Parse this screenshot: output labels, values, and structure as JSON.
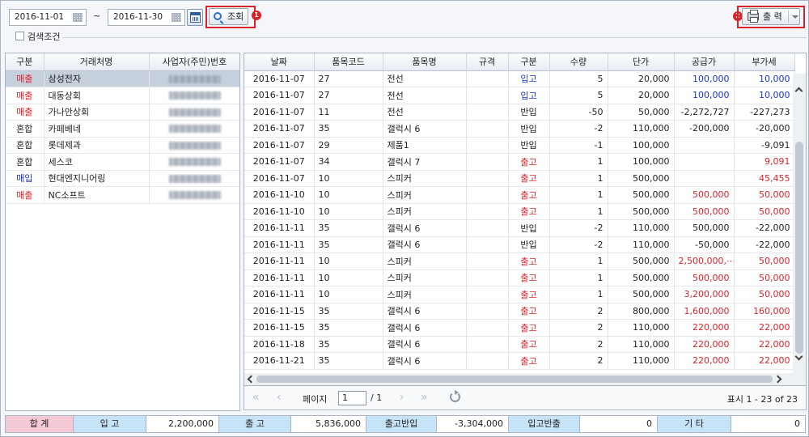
{
  "toolbar": {
    "start_date": "2016-11-01",
    "end_date": "2016-11-30",
    "tilde": "~",
    "search_label": "조회",
    "search_badge": "1",
    "print_label": "출 력",
    "print_badge": "2",
    "search_condition_label": "검색조건"
  },
  "left_table": {
    "headers": [
      "구분",
      "거래처명",
      "사업자(주민)번호"
    ],
    "rows": [
      {
        "type": "매출",
        "name": "삼성전자",
        "color": "#d9232a",
        "selected": true
      },
      {
        "type": "매출",
        "name": "대동상회",
        "color": "#d9232a"
      },
      {
        "type": "매출",
        "name": "가나안상회",
        "color": "#d9232a"
      },
      {
        "type": "혼합",
        "name": "카페베네",
        "color": "#222222"
      },
      {
        "type": "혼합",
        "name": "롯데제과",
        "color": "#222222"
      },
      {
        "type": "혼합",
        "name": "세스코",
        "color": "#222222"
      },
      {
        "type": "매입",
        "name": "현대엔지니어링",
        "color": "#1a35c8"
      },
      {
        "type": "매출",
        "name": "NC소프트",
        "color": "#d9232a"
      }
    ]
  },
  "right_table": {
    "headers": [
      "날짜",
      "품목코드",
      "품목명",
      "규격",
      "구분",
      "수량",
      "단가",
      "공급가",
      "부가세"
    ],
    "rows": [
      {
        "date": "2016-11-07",
        "code": "27",
        "item": "전선",
        "spec": "",
        "kind": "입고",
        "qty": "5",
        "price": "20,000",
        "supply": "100,000",
        "vat": "10,000",
        "kc": "blue",
        "sc": "blue",
        "vc": "blue"
      },
      {
        "date": "2016-11-07",
        "code": "27",
        "item": "전선",
        "spec": "",
        "kind": "입고",
        "qty": "5",
        "price": "20,000",
        "supply": "100,000",
        "vat": "10,000",
        "kc": "blue",
        "sc": "blue",
        "vc": "blue"
      },
      {
        "date": "2016-11-07",
        "code": "11",
        "item": "전선",
        "spec": "",
        "kind": "반입",
        "qty": "-50",
        "price": "50,000",
        "supply": "-2,272,727",
        "vat": "-227,273",
        "kc": "",
        "sc": "",
        "vc": ""
      },
      {
        "date": "2016-11-07",
        "code": "35",
        "item": "갤럭시 6",
        "spec": "",
        "kind": "반입",
        "qty": "-2",
        "price": "110,000",
        "supply": "-200,000",
        "vat": "-20,000",
        "kc": "",
        "sc": "",
        "vc": ""
      },
      {
        "date": "2016-11-07",
        "code": "29",
        "item": "제품1",
        "spec": "",
        "kind": "반입",
        "qty": "-1",
        "price": "100,000",
        "supply": "",
        "vat": "-9,091",
        "kc": "",
        "sc": "",
        "vc": ""
      },
      {
        "date": "2016-11-07",
        "code": "34",
        "item": "갤럭시 7",
        "spec": "",
        "kind": "출고",
        "qty": "1",
        "price": "100,000",
        "supply": "",
        "vat": "9,091",
        "kc": "red",
        "sc": "",
        "vc": "red"
      },
      {
        "date": "2016-11-07",
        "code": "10",
        "item": "스피커",
        "spec": "",
        "kind": "출고",
        "qty": "1",
        "price": "500,000",
        "supply": "",
        "vat": "45,455",
        "kc": "red",
        "sc": "",
        "vc": "red"
      },
      {
        "date": "2016-11-10",
        "code": "10",
        "item": "스피커",
        "spec": "",
        "kind": "출고",
        "qty": "1",
        "price": "500,000",
        "supply": "500,000",
        "vat": "50,000",
        "kc": "red",
        "sc": "red",
        "vc": "red"
      },
      {
        "date": "2016-11-10",
        "code": "10",
        "item": "스피커",
        "spec": "",
        "kind": "출고",
        "qty": "1",
        "price": "500,000",
        "supply": "500,000",
        "vat": "50,000",
        "kc": "red",
        "sc": "red",
        "vc": "red"
      },
      {
        "date": "2016-11-11",
        "code": "35",
        "item": "갤럭시 6",
        "spec": "",
        "kind": "반입",
        "qty": "-2",
        "price": "110,000",
        "supply": "500,000",
        "vat": "-22,000",
        "kc": "",
        "sc": "",
        "vc": ""
      },
      {
        "date": "2016-11-11",
        "code": "35",
        "item": "갤럭시 6",
        "spec": "",
        "kind": "반입",
        "qty": "-2",
        "price": "110,000",
        "supply": "-50,000",
        "vat": "-22,000",
        "kc": "",
        "sc": "",
        "vc": ""
      },
      {
        "date": "2016-11-11",
        "code": "10",
        "item": "스피커",
        "spec": "",
        "kind": "출고",
        "qty": "1",
        "price": "500,000",
        "supply": "2,500,000,⋯",
        "vat": "50,000",
        "kc": "red",
        "sc": "red",
        "vc": "red"
      },
      {
        "date": "2016-11-11",
        "code": "10",
        "item": "스피커",
        "spec": "",
        "kind": "출고",
        "qty": "1",
        "price": "500,000",
        "supply": "500,000",
        "vat": "50,000",
        "kc": "red",
        "sc": "red",
        "vc": "red"
      },
      {
        "date": "2016-11-11",
        "code": "10",
        "item": "스피커",
        "spec": "",
        "kind": "출고",
        "qty": "1",
        "price": "500,000",
        "supply": "3,200,000",
        "vat": "50,000",
        "kc": "red",
        "sc": "red",
        "vc": "red"
      },
      {
        "date": "2016-11-15",
        "code": "35",
        "item": "갤럭시 6",
        "spec": "",
        "kind": "출고",
        "qty": "2",
        "price": "800,000",
        "supply": "1,600,000",
        "vat": "160,000",
        "kc": "red",
        "sc": "red",
        "vc": "red"
      },
      {
        "date": "2016-11-15",
        "code": "35",
        "item": "갤럭시 6",
        "spec": "",
        "kind": "출고",
        "qty": "2",
        "price": "110,000",
        "supply": "220,000",
        "vat": "22,000",
        "kc": "red",
        "sc": "red",
        "vc": "red"
      },
      {
        "date": "2016-11-18",
        "code": "35",
        "item": "갤럭시 6",
        "spec": "",
        "kind": "출고",
        "qty": "2",
        "price": "110,000",
        "supply": "220,000",
        "vat": "22,000",
        "kc": "red",
        "sc": "red",
        "vc": "red"
      },
      {
        "date": "2016-11-21",
        "code": "35",
        "item": "갤럭시 6",
        "spec": "",
        "kind": "출고",
        "qty": "2",
        "price": "110,000",
        "supply": "220,000",
        "vat": "22,000",
        "kc": "red",
        "sc": "red",
        "vc": "red"
      }
    ]
  },
  "pager": {
    "page_label": "페이지",
    "page_value": "1",
    "page_total": "/ 1",
    "status": "표시 1 - 23 of 23"
  },
  "summary": {
    "total_label": "합 계",
    "in_label": "입 고",
    "in_value": "2,200,000",
    "out_label": "출 고",
    "out_value": "5,836,000",
    "out_return_label": "출고반입",
    "out_return_value": "-3,304,000",
    "in_return_label": "입고반출",
    "in_return_value": "0",
    "etc_label": "기 타",
    "etc_value": "0"
  },
  "colors": {
    "accent_red": "#d9232a",
    "accent_blue": "#1a35c8",
    "selected_row": "#c6cfdc",
    "summary_label_bg": "#c6e3f7",
    "summary_total_bg": "#f6c9d6"
  }
}
